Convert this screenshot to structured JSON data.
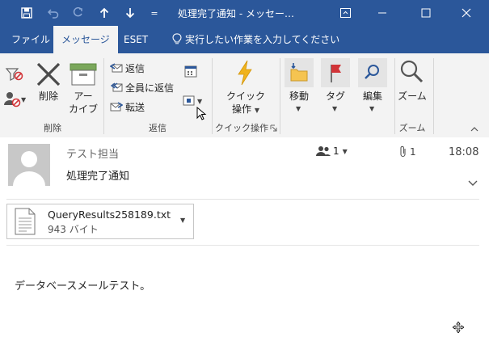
{
  "window": {
    "title": "処理完了通知 - メッセー…",
    "quick_access_more": "="
  },
  "tabs": [
    {
      "label": "ファイル"
    },
    {
      "label": "メッセージ"
    },
    {
      "label": "ESET"
    }
  ],
  "tell_me": "実行したい作業を入力してください",
  "ribbon": {
    "groups": {
      "delete": "削除",
      "respond": "返信",
      "quick_steps": "クイック操作",
      "zoom": "ズーム"
    },
    "buttons": {
      "delete": "削除",
      "archive_line1": "アー",
      "archive_line2": "カイブ",
      "reply": "返信",
      "reply_all": "全員に返信",
      "forward": "転送",
      "quick_steps_line1": "クイック",
      "quick_steps_line2": "操作",
      "move": "移動",
      "tags": "タグ",
      "editing": "編集",
      "zoom": "ズーム"
    }
  },
  "message": {
    "sender": "テスト担当",
    "subject": "処理完了通知",
    "people_count": "1",
    "attachment_count": "1",
    "time": "18:08",
    "attachment": {
      "name": "QueryResults258189.txt",
      "size": "943 バイト"
    },
    "body": "データベースメールテスト。"
  },
  "colors": {
    "titlebar": "#2b579a",
    "ribbon_bg": "#f3f3f3",
    "delete_x": "#4a4a4a",
    "flag_red": "#d13438",
    "quick_steps_yellow": "#f0b31c"
  }
}
